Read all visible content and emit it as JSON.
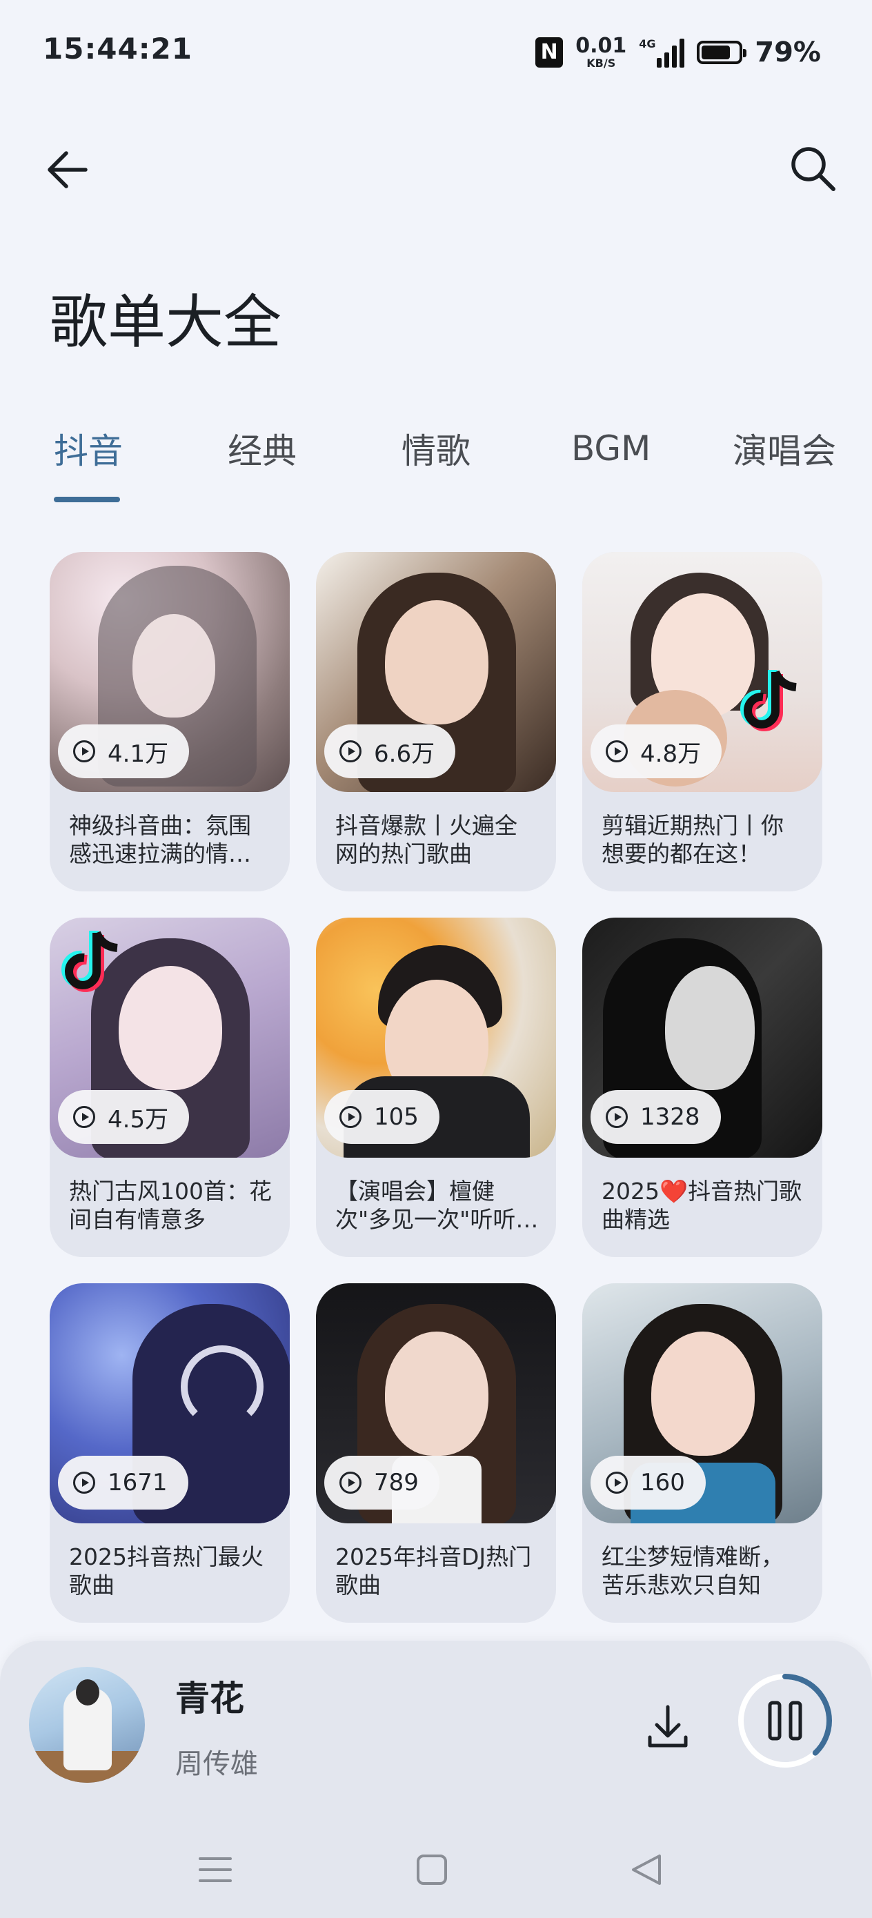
{
  "status": {
    "time": "15:44:21",
    "nfc_icon": "nfc-icon",
    "net_speed": "0.01",
    "net_unit": "KB/S",
    "network": "4G",
    "battery_level": 0.79,
    "battery": "79%"
  },
  "header": {
    "back_icon": "arrow-left-icon",
    "search_icon": "search-icon",
    "title": "歌单大全"
  },
  "tabs": [
    {
      "label": "抖音",
      "active": true
    },
    {
      "label": "经典",
      "active": false
    },
    {
      "label": "情歌",
      "active": false
    },
    {
      "label": "BGM",
      "active": false
    },
    {
      "label": "演唱会",
      "active": false
    }
  ],
  "playlists": [
    {
      "plays": "4.1万",
      "title": "神级抖音曲：氛围感迅速拉满的情歌合集"
    },
    {
      "plays": "6.6万",
      "title": "抖音爆款丨火遍全网的热门歌曲"
    },
    {
      "plays": "4.8万",
      "title": "剪辑近期热门丨你想要的都在这！"
    },
    {
      "plays": "4.5万",
      "title": "热门古风100首：花间自有情意多"
    },
    {
      "plays": "105",
      "title": "【演唱会】檀健次\"多见一次\"听听现场"
    },
    {
      "plays": "1328",
      "title": "2025❤️抖音热门歌曲精选"
    },
    {
      "plays": "1671",
      "title": "2025抖音热门最火歌曲"
    },
    {
      "plays": "789",
      "title": "2025年抖音DJ热门歌曲"
    },
    {
      "plays": "160",
      "title": "红尘梦短情难断，苦乐悲欢只自知"
    }
  ],
  "player": {
    "song": "青花",
    "artist": "周传雄",
    "download_icon": "download-icon",
    "pause_icon": "pause-icon",
    "progress": 0.38
  },
  "nav": {
    "menu_icon": "menu-icon",
    "home_icon": "home-icon",
    "back_icon": "back-triangle-icon"
  }
}
